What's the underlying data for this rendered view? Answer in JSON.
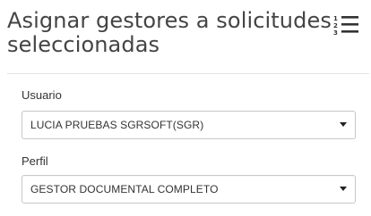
{
  "header": {
    "title": "Asignar gestores a solicitudes seleccionadas",
    "icon": "ordered-list-icon"
  },
  "form": {
    "usuario": {
      "label": "Usuario",
      "value": "LUCIA PRUEBAS SGRSOFT(SGR)"
    },
    "perfil": {
      "label": "Perfil",
      "value": "GESTOR DOCUMENTAL COMPLETO"
    }
  },
  "colors": {
    "text": "#333333",
    "title": "#444444",
    "border": "#c8c8c8",
    "divider": "#e3e3e3"
  }
}
